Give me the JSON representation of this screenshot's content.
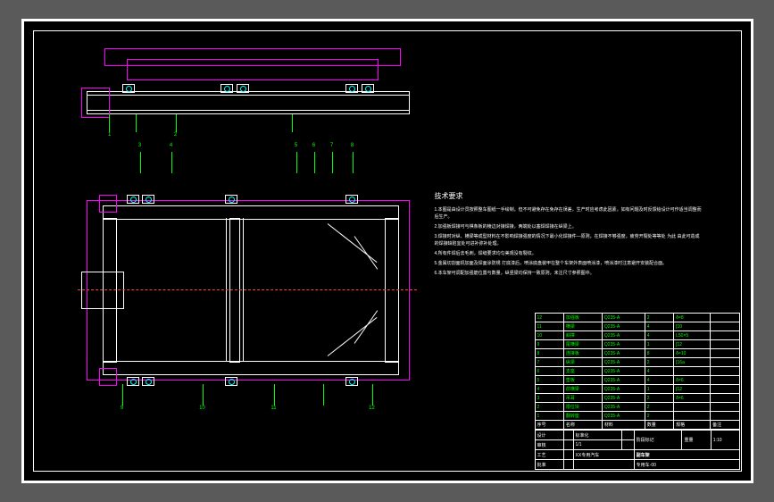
{
  "drawing": {
    "title": "副车架",
    "drawing_no": "专用车-00",
    "scale": "1:10",
    "sheet": "1/1"
  },
  "notes": {
    "heading": "技术要求",
    "lines": [
      "1.本图是由设计员按照整车图纸一手绘制，但不可避免存在免存在误差，生产时应考虑此因素，如有问题及时反馈给设计可作适当调整而后生产。",
      "2.加强板焊接可与棋条板的棱边对接焊接，两端处以塞焊焊接在纵梁上。",
      "3.焊接时对纵、横梁等成型材料在不影响焊接强度的情况下最小化焊接件—原则，在焊接不够强度，疲劳开裂处等等处 为此 由此可造成的焊接缺陷宜处可进补弥补处理。",
      "4.所有件焊后去毛刺，焊缝要求均匀美观没有裂纹。",
      "5.金属切割面机加面及焊面涂防锈 打底漆后，喷涂底盘装甲在整个车架外表面喷涂漆，喷涂漆时注意避开安装配合面。",
      "6.本车架可调配加强筋位置与数量，纵竖梁均保持一致原则，未注尺寸参照图中。"
    ]
  },
  "balloons_top": [
    "1",
    "2",
    "3",
    "4",
    "5",
    "6",
    "7",
    "8"
  ],
  "balloons_plan": [
    "9",
    "10",
    "11",
    "12"
  ],
  "bom": [
    {
      "no": "12",
      "name": "加强板",
      "mat": "Q235-A",
      "qty": "2",
      "spec": "δ=8",
      "note": ""
    },
    {
      "no": "11",
      "name": "横梁",
      "mat": "Q235-A",
      "qty": "4",
      "spec": "[10",
      "note": ""
    },
    {
      "no": "10",
      "name": "斜撑",
      "mat": "Q235-A",
      "qty": "4",
      "spec": "L50×5",
      "note": ""
    },
    {
      "no": "9",
      "name": "尾横梁",
      "mat": "Q235-A",
      "qty": "1",
      "spec": "[12",
      "note": ""
    },
    {
      "no": "8",
      "name": "连接板",
      "mat": "Q235-A",
      "qty": "8",
      "spec": "δ=10",
      "note": ""
    },
    {
      "no": "7",
      "name": "纵梁",
      "mat": "Q235-A",
      "qty": "2",
      "spec": "[16a",
      "note": ""
    },
    {
      "no": "6",
      "name": "支座",
      "mat": "Q235-A",
      "qty": "4",
      "spec": "",
      "note": ""
    },
    {
      "no": "5",
      "name": "垫板",
      "mat": "Q235-A",
      "qty": "4",
      "spec": "δ=6",
      "note": ""
    },
    {
      "no": "4",
      "name": "前横梁",
      "mat": "Q235-A",
      "qty": "1",
      "spec": "[12",
      "note": ""
    },
    {
      "no": "3",
      "name": "吊耳",
      "mat": "Q235-A",
      "qty": "2",
      "spec": "δ=6",
      "note": ""
    },
    {
      "no": "2",
      "name": "限位块",
      "mat": "Q235-A",
      "qty": "2",
      "spec": "",
      "note": ""
    },
    {
      "no": "1",
      "name": "翻转座",
      "mat": "Q235-A",
      "qty": "2",
      "spec": "",
      "note": ""
    }
  ],
  "bom_headers": {
    "no": "序号",
    "name": "名称",
    "mat": "材料",
    "qty": "数量",
    "spec": "规格",
    "note": "备注"
  },
  "tb": {
    "design": "设计",
    "check": "审核",
    "process": "工艺",
    "approve": "批准",
    "std": "标准化",
    "weight": "重量",
    "stage": "阶段标记",
    "company": "XX专用汽车"
  },
  "dims": {
    "overall_len": "",
    "overall_width": ""
  }
}
